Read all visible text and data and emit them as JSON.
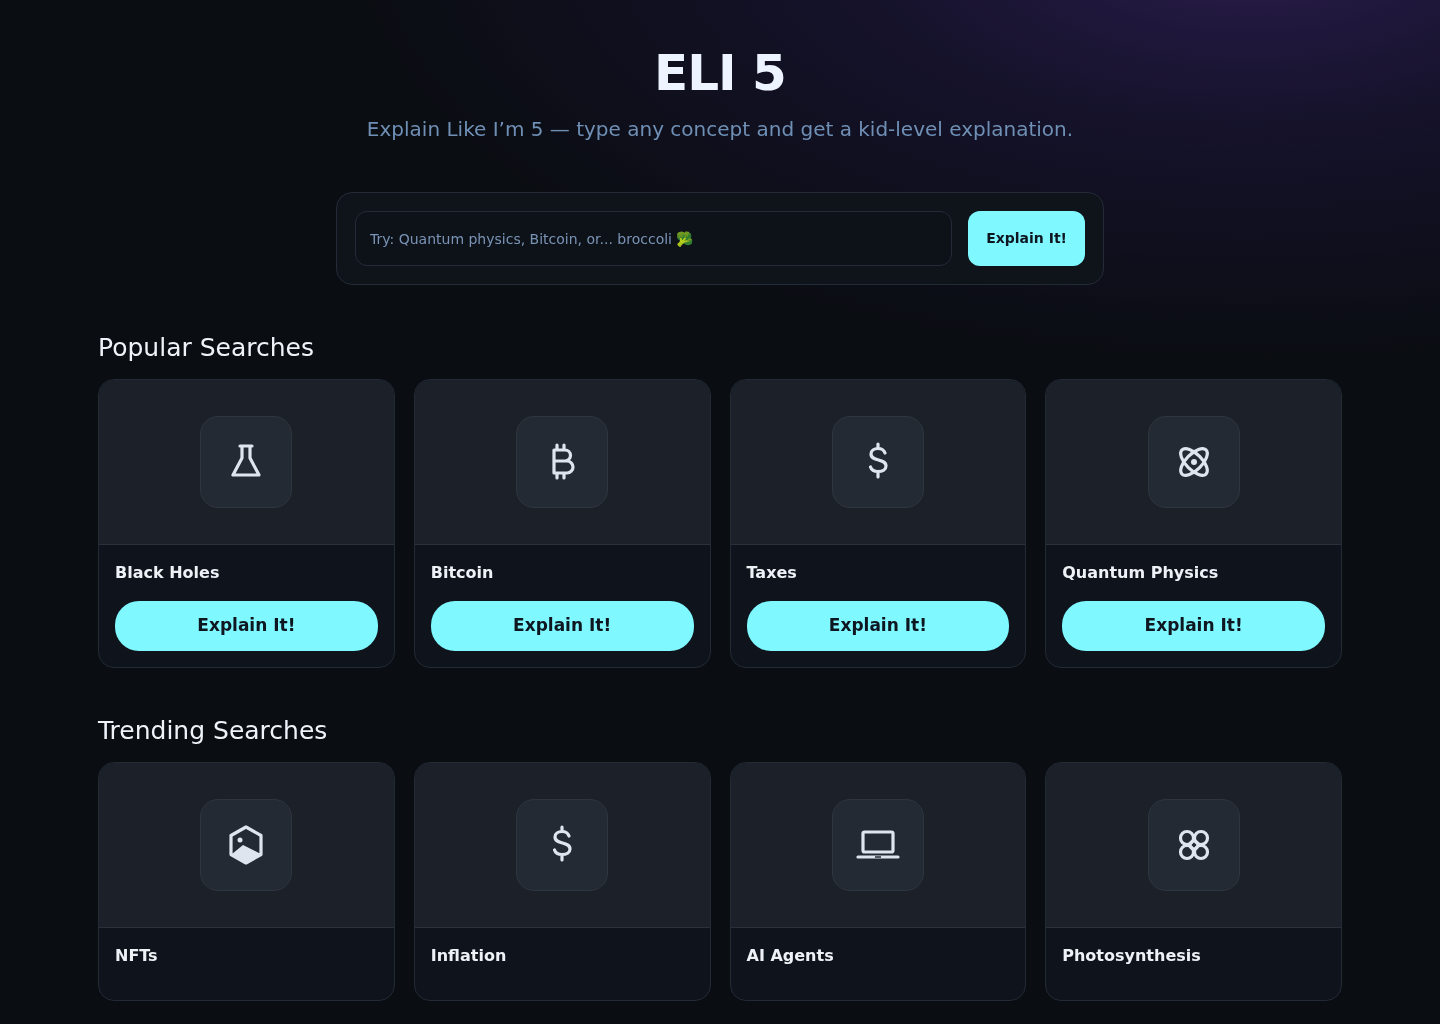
{
  "header": {
    "title": "ELI 5",
    "subtitle": "Explain Like I’m 5 — type any concept and get a kid-level explanation."
  },
  "search": {
    "placeholder": "Try: Quantum physics, Bitcoin, or... broccoli 🥦",
    "button": "Explain It!"
  },
  "sections": [
    {
      "heading": "Popular Searches",
      "cards": [
        {
          "title": "Black Holes",
          "button": "Explain It!"
        },
        {
          "title": "Bitcoin",
          "button": "Explain It!"
        },
        {
          "title": "Taxes",
          "button": "Explain It!"
        },
        {
          "title": "Quantum Physics",
          "button": "Explain It!"
        }
      ]
    },
    {
      "heading": "Trending Searches",
      "cards": [
        {
          "title": "NFTs"
        },
        {
          "title": "Inflation"
        },
        {
          "title": "AI Agents"
        },
        {
          "title": "Photosynthesis"
        }
      ]
    }
  ]
}
